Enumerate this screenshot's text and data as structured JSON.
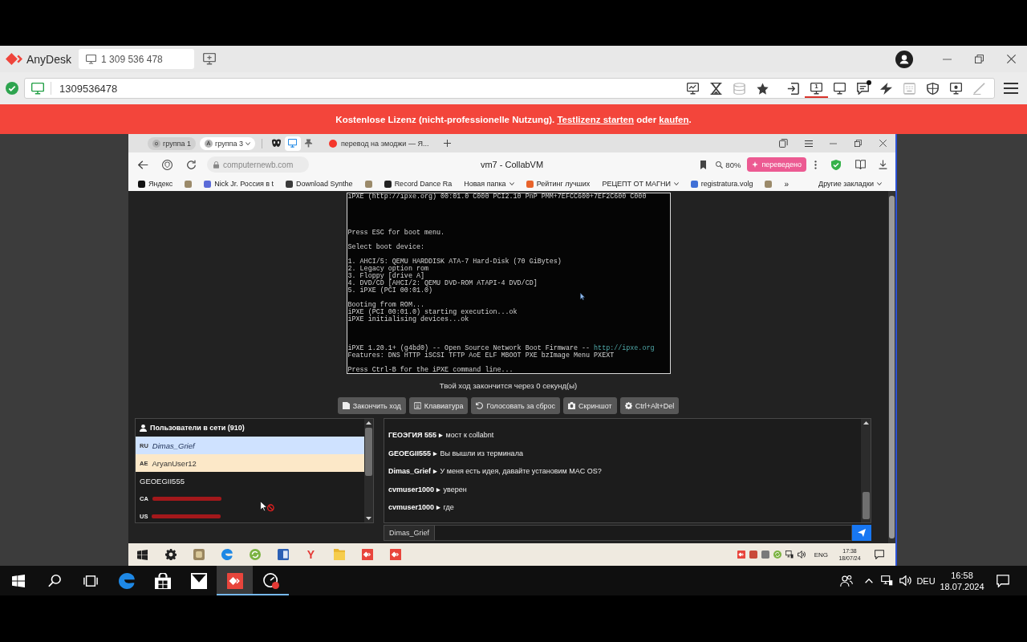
{
  "anydesk": {
    "app_name": "AnyDesk",
    "session_tab": {
      "label": "1 309 536 478",
      "selected": true
    },
    "address": {
      "value": "1309536478"
    },
    "toolbar": [
      [
        {
          "kind": "display",
          "selected": false,
          "disabled": false,
          "unread": false
        },
        {
          "kind": "hourglass",
          "selected": false,
          "disabled": false,
          "unread": false
        },
        {
          "kind": "database",
          "selected": false,
          "disabled": true,
          "unread": false
        },
        {
          "kind": "star",
          "selected": false,
          "disabled": false,
          "unread": false
        }
      ],
      [
        {
          "kind": "transfer",
          "selected": false,
          "disabled": false,
          "unread": false
        },
        {
          "kind": "monitor",
          "glyph": "1",
          "selected": true,
          "disabled": false,
          "unread": false
        },
        {
          "kind": "monitor",
          "selected": false,
          "disabled": false,
          "unread": false
        },
        {
          "kind": "chat",
          "selected": false,
          "disabled": false,
          "unread": true
        },
        {
          "kind": "lightning",
          "selected": false,
          "disabled": false,
          "unread": false
        },
        {
          "kind": "keyboard",
          "selected": false,
          "disabled": true,
          "unread": false
        },
        {
          "kind": "shield",
          "selected": false,
          "disabled": false,
          "unread": false
        },
        {
          "kind": "record",
          "selected": false,
          "disabled": false,
          "unread": false
        },
        {
          "kind": "pen",
          "selected": false,
          "disabled": true,
          "unread": false
        }
      ]
    ],
    "banner": [
      {
        "kind": "text",
        "text": "Kostenlose Lizenz (nicht-professionelle Nutzung). "
      },
      {
        "kind": "link",
        "text": "Testlizenz starten"
      },
      {
        "kind": "text",
        "text": " oder "
      },
      {
        "kind": "link",
        "text": "kaufen"
      },
      {
        "kind": "text",
        "text": "."
      }
    ]
  },
  "browser": {
    "tab_groups": [
      {
        "badge": "о",
        "label": "группа 1",
        "expanded": false
      },
      {
        "badge": "А",
        "label": "группа 3",
        "expanded": true
      }
    ],
    "pinned_tabs": [
      {
        "kind": "mask",
        "selected": false
      },
      {
        "kind": "monitor",
        "selected": true
      },
      {
        "kind": "pin",
        "selected": false
      }
    ],
    "tabs": [
      {
        "label": "перевод на эмоджи — Я...",
        "selected": false
      }
    ],
    "address": "computernewb.com",
    "page_title": "vm7 - CollabVM",
    "zoom": "80%",
    "translate_button": "переведено",
    "bookmarks": [
      {
        "kind": "link",
        "label": "Яндекс"
      },
      {
        "kind": "icon"
      },
      {
        "kind": "link",
        "label": "Nick Jr. Россия в t"
      },
      {
        "kind": "link",
        "label": "Download Synthe"
      },
      {
        "kind": "icon"
      },
      {
        "kind": "link",
        "label": "Record Dance Ra"
      },
      {
        "kind": "folder",
        "label": "Новая папка"
      },
      {
        "kind": "link",
        "label": "Рейтинг лучших"
      },
      {
        "kind": "folder",
        "label": "РЕЦЕПТ ОТ МАГНИ"
      },
      {
        "kind": "link",
        "label": "registratura.volg"
      },
      {
        "kind": "icon"
      }
    ],
    "bookmarks_overflow": "»",
    "other_bookmarks": "Другие закладки"
  },
  "collabvm": {
    "screen": [
      [
        {
          "text": "iPXE (http://ipxe.org) 00:01.0 C000 PCI2.10 PnP PMM+7EFCC600+7EF2C600 C000"
        }
      ],
      [
        {
          "text": "Press ESC for boot menu."
        }
      ],
      [
        {
          "text": "Select boot device:"
        }
      ],
      [
        {
          "text": "1. AHCI/5: QEMU HARDDISK ATA-7 Hard-Disk (70 GiBytes)"
        },
        {
          "text": "2. Legacy option rom"
        },
        {
          "text": "3. Floppy [drive A]"
        },
        {
          "text": "4. DVD/CD [AHCI/2: QEMU DVD-ROM ATAPI-4 DVD/CD]"
        },
        {
          "text": "5. iPXE (PCI 00:01.0)"
        }
      ],
      [
        {
          "text": "Booting from ROM..."
        },
        {
          "text": "iPXE (PCI 00:01.0) starting execution...ok"
        },
        {
          "text": "iPXE initialising devices...ok"
        }
      ],
      [
        {
          "text": "iPXE 1.20.1+ (g4bd0) -- Open Source Network Boot Firmware -- ",
          "link": "http://ipxe.org"
        },
        {
          "text": "Features: DNS HTTP iSCSI TFTP AoE ELF MBOOT PXE bzImage Menu PXEXT"
        }
      ],
      [
        {
          "text": "Press Ctrl-B for the iPXE command line..."
        }
      ]
    ],
    "turn_status": "Твой ход закончится через 0 секунд(ы)",
    "actions": [
      {
        "kind": "end-turn",
        "label": "Закончить ход"
      },
      {
        "kind": "keyboard",
        "label": "Клавиатура"
      },
      {
        "kind": "vote-reset",
        "label": "Голосовать за сброс"
      },
      {
        "kind": "screenshot",
        "label": "Скриншот"
      },
      {
        "kind": "ctrl-alt-del",
        "label": "Ctrl+Alt+Del"
      }
    ],
    "users": {
      "title": "Пользователи в сети (910)",
      "rows": [
        {
          "kind": "turn",
          "country": "RU",
          "name": "Dimas_Grief",
          "self": true
        },
        {
          "kind": "waiting",
          "country": "AE",
          "name": "AryanUser12",
          "self": false
        },
        {
          "kind": "user",
          "name": "GEOEGII555",
          "self": false
        },
        {
          "kind": "illegible",
          "country": "CA"
        },
        {
          "kind": "illegible",
          "country": "US"
        }
      ]
    },
    "chat": {
      "messages": [
        {
          "user": "ГЕОЭГИЯ 555 ▸",
          "text": "мост к collabnt"
        },
        {
          "user": "GEOEGII555 ▸",
          "text": "Вы вышли из терминала"
        },
        {
          "user": "Dimas_Grief ▸",
          "text": "У меня есть идея, давайте установим MAC OS?"
        },
        {
          "user": "cvmuser1000 ▸",
          "text": "уверен"
        },
        {
          "user": "cvmuser1000 ▸",
          "text": "где"
        }
      ],
      "username": "Dimas_Grief"
    }
  },
  "remote_taskbar": {
    "apps": [
      {
        "kind": "settings"
      },
      {
        "kind": "app"
      },
      {
        "kind": "edge"
      },
      {
        "kind": "sync"
      },
      {
        "kind": "word"
      },
      {
        "kind": "yandex",
        "glyph": "Y"
      },
      {
        "kind": "folder"
      },
      {
        "kind": "anydesk"
      },
      {
        "kind": "anydesk"
      }
    ],
    "language": "ENG",
    "time": "17:38",
    "date": "18/07/24"
  },
  "taskbar": {
    "apps": [
      {
        "kind": "edge",
        "running": false,
        "selected": false
      },
      {
        "kind": "store",
        "running": false,
        "selected": false
      },
      {
        "kind": "mail",
        "running": false,
        "selected": false
      },
      {
        "kind": "anydesk",
        "running": true,
        "selected": true
      },
      {
        "kind": "recorder",
        "running": true,
        "selected": false
      }
    ],
    "language": "DEU",
    "time": "16:58",
    "date": "18.07.2024"
  }
}
